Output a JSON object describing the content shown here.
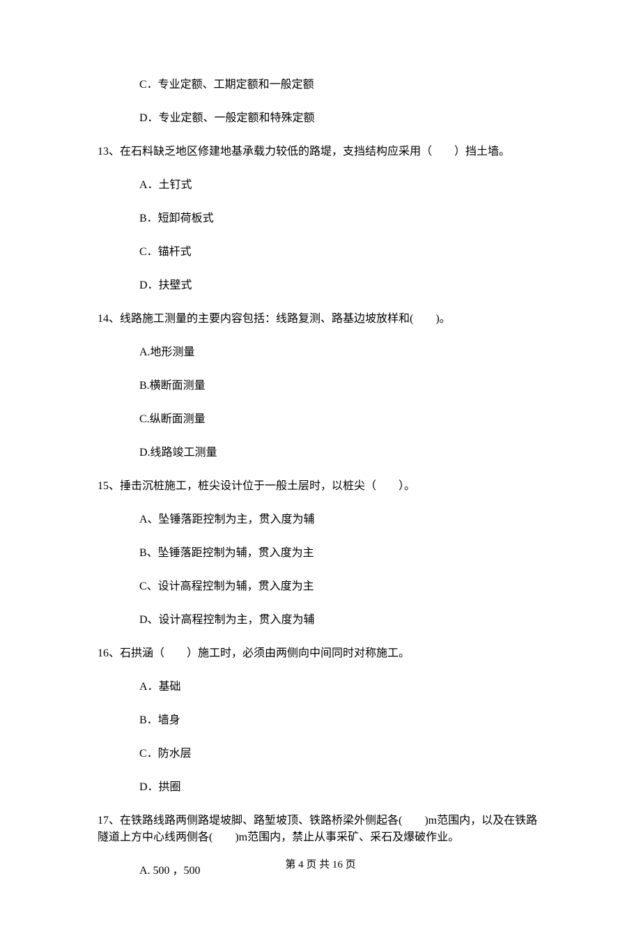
{
  "orphan_options": {
    "c": "C．专业定额、工期定额和一般定额",
    "d": "D．专业定额、一般定额和特殊定额"
  },
  "q13": {
    "stem": "13、在石料缺乏地区修建地基承载力较低的路堤，支挡结构应采用（　　）挡土墙。",
    "a": "A．土钉式",
    "b": "B．短卸荷板式",
    "c": "C．锚杆式",
    "d": "D．扶壁式"
  },
  "q14": {
    "stem": "14、线路施工测量的主要内容包括：线路复测、路基边坡放样和(　　)。",
    "a": "A.地形测量",
    "b": "B.横断面测量",
    "c": "C.纵断面测量",
    "d": "D.线路竣工测量"
  },
  "q15": {
    "stem": "15、捶击沉桩施工，桩尖设计位于一般土层时，以桩尖（　　）。",
    "a": "A、坠锤落距控制为主，贯入度为辅",
    "b": "B、坠锤落距控制为辅，贯入度为主",
    "c": "C、设计高程控制为辅，贯入度为主",
    "d": "D、设计高程控制为主，贯入度为辅"
  },
  "q16": {
    "stem": "16、石拱涵（　　）施工时，必须由两侧向中间同时对称施工。",
    "a": "A．基础",
    "b": "B．墙身",
    "c": "C．防水层",
    "d": "D．拱圈"
  },
  "q17": {
    "stem": "17、在铁路线路两侧路堤坡脚、路堑坡顶、铁路桥梁外侧起各(　　)m范围内，以及在铁路隧道上方中心线两侧各(　　)m范围内，禁止从事采矿、采石及爆破作业。",
    "a": "A. 500 ，500"
  },
  "footer": "第 4 页 共 16 页"
}
